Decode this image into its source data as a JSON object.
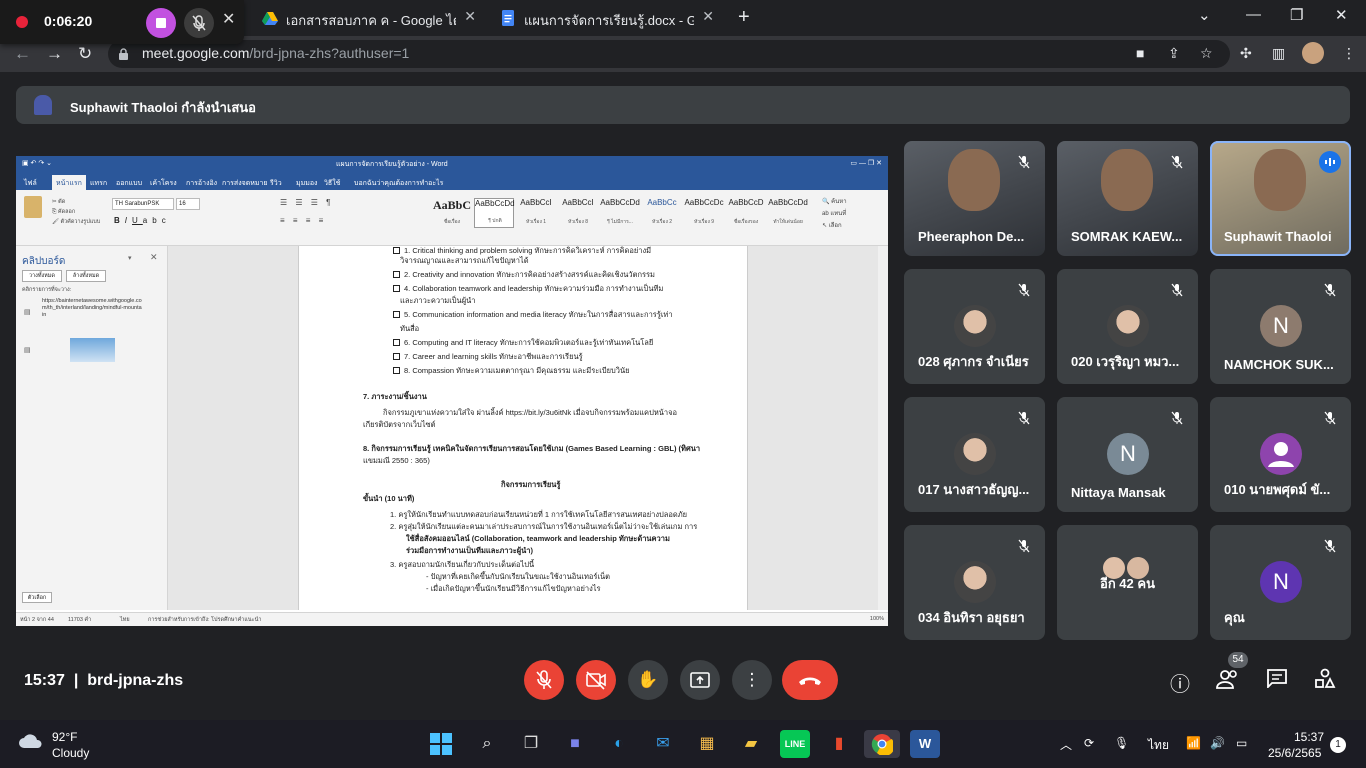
{
  "recorder": {
    "time": "0:06:20"
  },
  "browser": {
    "tabs": [
      {
        "label": "เอกสารสอบภาค ค - Google ไดรฟ์"
      },
      {
        "label": "แผนการจัดการเรียนรู้.docx - Google"
      }
    ],
    "url_host": "meet.google.com",
    "url_path": "/brd-jpna-zhs?authuser=1"
  },
  "meet": {
    "presenting": "Suphawit Thaoloi กำลังนำเสนอ",
    "participants": [
      {
        "name": "Pheeraphon De...",
        "type": "video"
      },
      {
        "name": "SOMRAK KAEW...",
        "type": "video"
      },
      {
        "name": "Suphawit Thaoloi",
        "type": "video",
        "speaking": true
      },
      {
        "name": "028 ศุภากร จำเนียร",
        "type": "photo"
      },
      {
        "name": "020 เวรุริญา หมว...",
        "type": "photo"
      },
      {
        "name": "NAMCHOK SUK...",
        "type": "letter",
        "letter": "N",
        "color": "#8d7b6e"
      },
      {
        "name": "017 นางสาวธัญญ...",
        "type": "photo"
      },
      {
        "name": "Nittaya Mansak",
        "type": "letter",
        "letter": "N",
        "color": "#7a8a96"
      },
      {
        "name": "010 นายพศุดม์ ขั...",
        "type": "person",
        "color": "#8e44ad"
      },
      {
        "name": "034 อินทิรา อยุธยา",
        "type": "photo"
      },
      {
        "name": "อีก 42 คน",
        "type": "others"
      },
      {
        "name": "คุณ",
        "type": "letter",
        "letter": "N",
        "color": "#5e35b1"
      }
    ],
    "meeting_time": "15:37",
    "meeting_code": "brd-jpna-zhs",
    "people_count": "54"
  },
  "word": {
    "title": "แผนการจัดการเรียนรู้ตัวอย่าง - Word",
    "ribbon_tabs": [
      "ไฟล์",
      "หน้าแรก",
      "แทรก",
      "ออกแบบ",
      "เค้าโครง",
      "การอ้างอิง",
      "การส่งจดหมาย",
      "รีวิว",
      "มุมมอง",
      "วิธีใช้",
      "บอกฉันว่าคุณต้องการทำอะไร"
    ],
    "styles": [
      {
        "sample": "AaBbC",
        "name": "ชื่อเรื่อง"
      },
      {
        "sample": "AaBbCcDd",
        "name": "¶ ปกติ"
      },
      {
        "sample": "AaBbCcI",
        "name": "หัวเรื่อง 1"
      },
      {
        "sample": "AaBbCcI",
        "name": "หัวเรื่อง 8"
      },
      {
        "sample": "AaBbCcDd",
        "name": "¶ ไม่มีการ..."
      },
      {
        "sample": "AaBbCc",
        "name": "หัวเรื่อง 2"
      },
      {
        "sample": "AaBbCcDc",
        "name": "หัวเรื่อง 9"
      },
      {
        "sample": "AaBbCcD",
        "name": "ชื่อเรื่องรอง"
      },
      {
        "sample": "AaBbCcDd",
        "name": "ทำให้เด่นน้อย"
      }
    ],
    "font": "TH SarabunPSK",
    "size": "16",
    "clipboard": {
      "title": "คลิปบอร์ด",
      "btn_paste_all": "วางทั้งหมด",
      "btn_clear_all": "ล้างทั้งหมด",
      "hint": "คลิกรายการที่จะวาง:",
      "item_text": "https://bainternetawesome.withgoogle.com/th_th/interland/landing/mindful-mountain",
      "options": "ตัวเลือก"
    },
    "doc_lines": [
      "1. Critical thinking and problem solving ทักษะการคิดวิเคราะห์ การคิดอย่างมี",
      "วิจารณญาณและสามารถแก้ไขปัญหาได้",
      "2. Creativity and innovation ทักษะการคิดอย่างสร้างสรรค์และคิดเชิงนวัตกรรม",
      "4. Collaboration teamwork and leadership ทักษะความร่วมมือ การทำงานเป็นทีม",
      "และภาวะความเป็นผู้นำ",
      "5. Communication information and media literacy ทักษะในการสื่อสารและการรู้เท่า",
      "ทันสื่อ",
      "6. Computing and IT literacy ทักษะการใช้คอมพิวเตอร์และรู้เท่าทันเทคโนโลยี",
      "7. Career and learning skills ทักษะอาชีพและการเรียนรู้",
      "8. Compassion ทักษะความเมตตากรุณา มีคุณธรรม และมีระเบียบวินัย",
      "7. ภาระงาน/ชิ้นงาน",
      "กิจกรรมภูเขาแห่งความใส่ใจ ผ่านลิ้งค์ https://bit.ly/3u6itNk เมื่อจบกิจกรรมพร้อมแคปหน้าจอ",
      "เกียรติบัตรจากเว็บไซต์",
      "8. กิจกรรมการเรียนรู้ เทคนิคในจัดการเรียนการสอนโดยใช้เกม (Games Based Learning : GBL) (ทิศนา",
      "แขมมณี 2550 : 365)",
      "กิจกรรมการเรียนรู้",
      "ขั้นนำ (10 นาที)",
      "1.   ครูให้นักเรียนทำแบบทดสอบก่อนเรียนหน่วยที่ 1 การใช้เทคโนโลยีสารสนเทศอย่างปลอดภัย",
      "2.   ครูสุ่มให้นักเรียนแต่ละคนมาเล่าประสบการณ์ในการใช้งานอินเทอร์เน็ตไม่ว่าจะใช้เล่นเกม การ",
      "ใช้สื่อสังคมออนไลน์ (Collaboration, teamwork and leadership ทักษะด้านความ",
      "ร่วมมือการทำงานเป็นทีมและภาวะผู้นำ)",
      "3.   ครูสอบถามนักเรียนเกี่ยวกับประเด็นต่อไปนี้",
      "- ปัญหาที่เคยเกิดขึ้นกับนักเรียนในขณะใช้งานอินเทอร์เน็ต",
      "- เมื่อเกิดปัญหาขึ้นนักเรียนมีวิธีการแก้ไขปัญหาอย่างไร"
    ],
    "status": {
      "page": "หน้า 2 จาก 44",
      "words": "11703 คำ",
      "lang": "ไทย",
      "access": "การช่วยสำหรับการเข้าถึง: โปรดศึกษาคำแนะนำ",
      "zoom": "100%"
    }
  },
  "taskbar": {
    "weather_temp": "92°F",
    "weather_desc": "Cloudy",
    "lang": "ไทย",
    "time": "15:37",
    "date": "25/6/2565",
    "notif": "1"
  }
}
